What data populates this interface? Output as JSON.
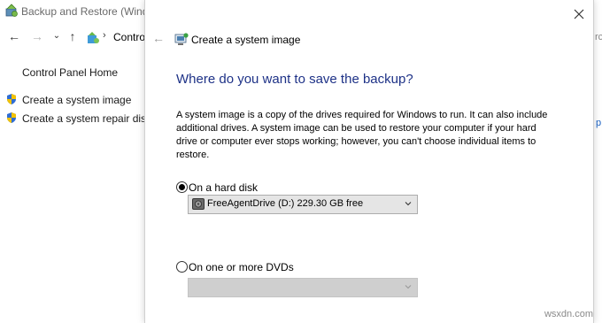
{
  "background_window": {
    "title": "Backup and Restore (Windows",
    "address_text": "Control",
    "left_pane": {
      "home_link": "Control Panel Home",
      "links": [
        "Create a system image",
        "Create a system repair disc"
      ]
    },
    "right_edge_top": "rc",
    "right_edge_mid": "p"
  },
  "dialog": {
    "title": "Create a system image",
    "heading": "Where do you want to save the backup?",
    "description": "A system image is a copy of the drives required for Windows to run. It can also include additional drives. A system image can be used to restore your computer if your hard drive or computer ever stops working; however, you can't choose individual items to restore.",
    "options": {
      "hard_disk": {
        "label": "On a hard disk",
        "selected": true,
        "dropdown_value": "FreeAgentDrive (D:)  229.30 GB free"
      },
      "dvds": {
        "label": "On one or more DVDs",
        "selected": false,
        "dropdown_value": ""
      }
    }
  },
  "watermark": "wsxdn.com",
  "icons": {
    "close": "close-icon",
    "back": "back-arrow-icon",
    "shield": "uac-shield-icon",
    "drive": "hard-drive-icon"
  },
  "colors": {
    "heading": "#1e3287",
    "link": "#1a62c4"
  }
}
